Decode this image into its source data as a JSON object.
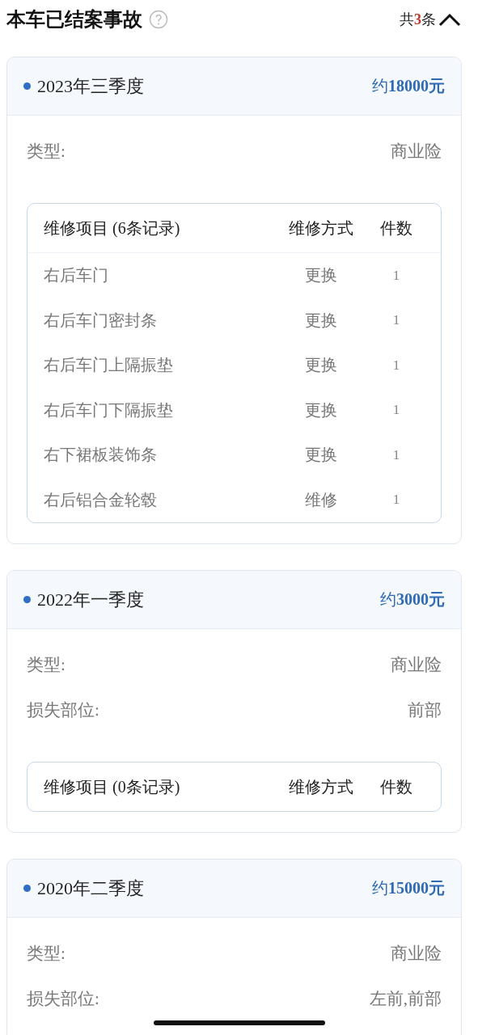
{
  "header": {
    "title": "本车已结案事故",
    "count_prefix": "共",
    "count": "3",
    "count_suffix": "条",
    "expanded": true
  },
  "cases": [
    {
      "period": "2023年三季度",
      "amount": "约**18000元**",
      "fields": [
        {
          "label": "类型:",
          "value": "商业险"
        }
      ],
      "repair": {
        "title": "维修项目 (6条记录)",
        "method_header": "维修方式",
        "qty_header": "件数",
        "rows": [
          {
            "item": "右后车门",
            "method": "更换",
            "qty": "1"
          },
          {
            "item": "右后车门密封条",
            "method": "更换",
            "qty": "1"
          },
          {
            "item": "右后车门上隔振垫",
            "method": "更换",
            "qty": "1"
          },
          {
            "item": "右后车门下隔振垫",
            "method": "更换",
            "qty": "1"
          },
          {
            "item": "右下裙板装饰条",
            "method": "更换",
            "qty": "1"
          },
          {
            "item": "右后铝合金轮毂",
            "method": "维修",
            "qty": "1"
          }
        ]
      }
    },
    {
      "period": "2022年一季度",
      "amount": "约**3000元**",
      "fields": [
        {
          "label": "类型:",
          "value": "商业险"
        },
        {
          "label": "损失部位:",
          "value": "前部"
        }
      ],
      "repair": {
        "title": "维修项目 (0条记录)",
        "method_header": "维修方式",
        "qty_header": "件数"
      }
    },
    {
      "period": "2020年二季度",
      "amount": "约**15000元**",
      "fields": [
        {
          "label": "类型:",
          "value": "商业险"
        },
        {
          "label": "损失部位:",
          "value": "左前,前部"
        }
      ]
    }
  ]
}
